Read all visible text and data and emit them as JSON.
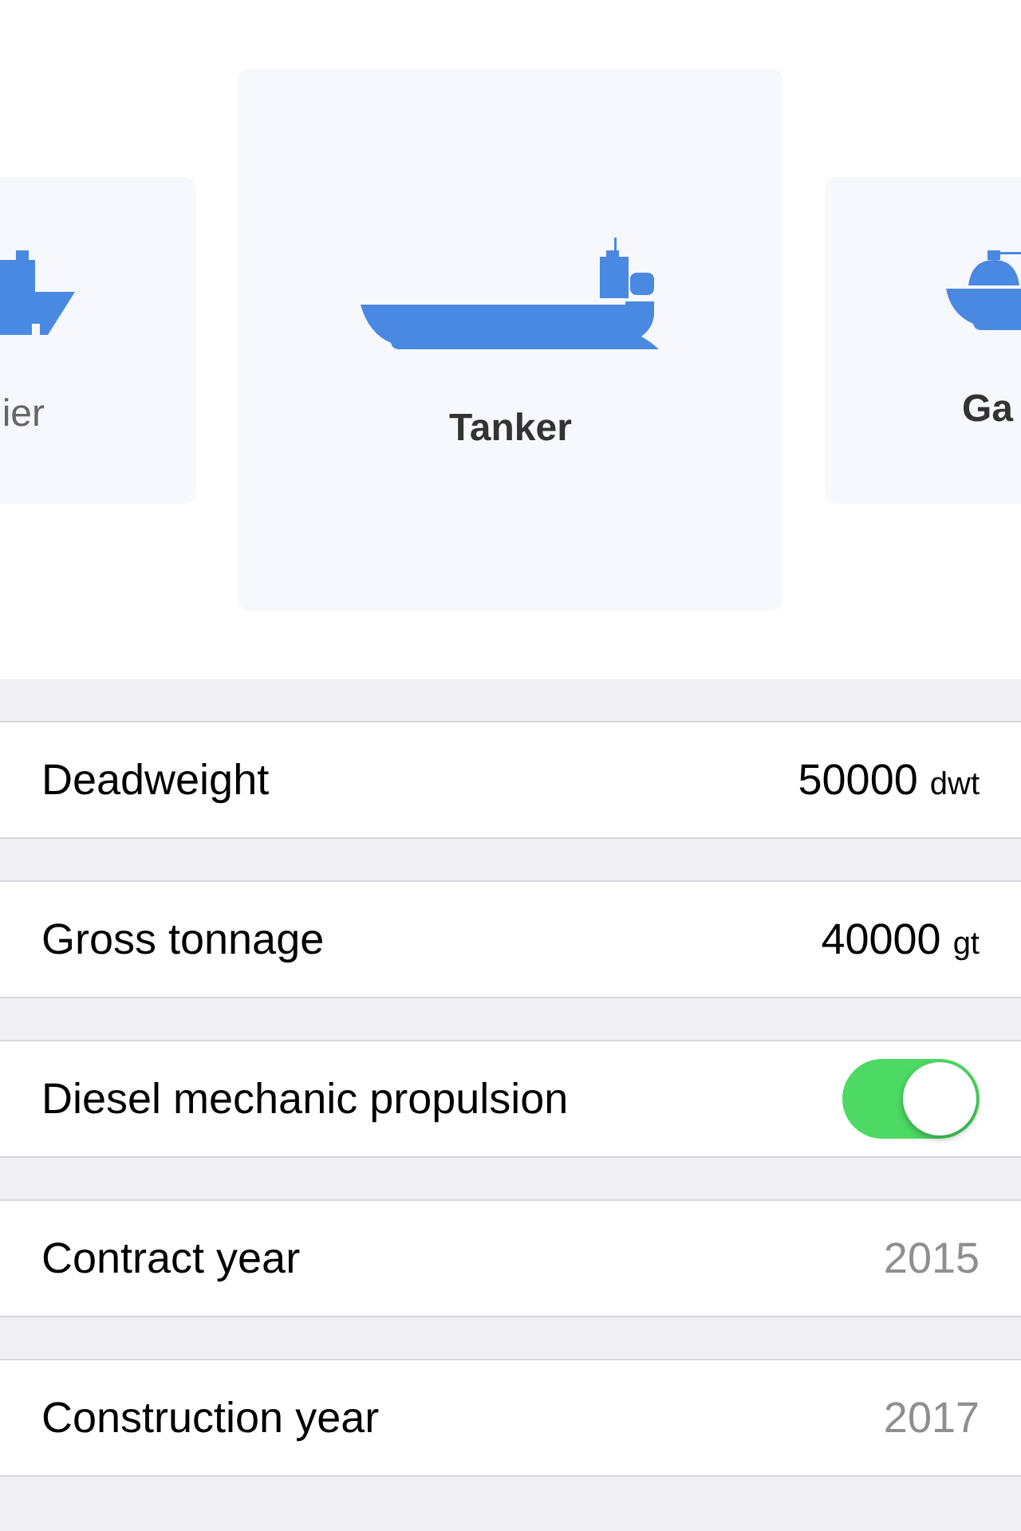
{
  "ship_types": [
    {
      "kind": "bulk",
      "label": "ier",
      "selected": false
    },
    {
      "kind": "tanker",
      "label": "Tanker",
      "selected": true
    },
    {
      "kind": "gas",
      "label": "Ga",
      "selected": false
    }
  ],
  "rows": [
    {
      "kind": "measure",
      "label": "Deadweight",
      "value": "50000",
      "unit": "dwt"
    },
    {
      "kind": "measure",
      "label": "Gross tonnage",
      "value": "40000",
      "unit": "gt"
    },
    {
      "kind": "toggle",
      "label": "Diesel mechanic propulsion",
      "on": true
    },
    {
      "kind": "picker",
      "label": "Contract year",
      "value": "2015"
    },
    {
      "kind": "picker",
      "label": "Construction year",
      "value": "2017"
    }
  ]
}
